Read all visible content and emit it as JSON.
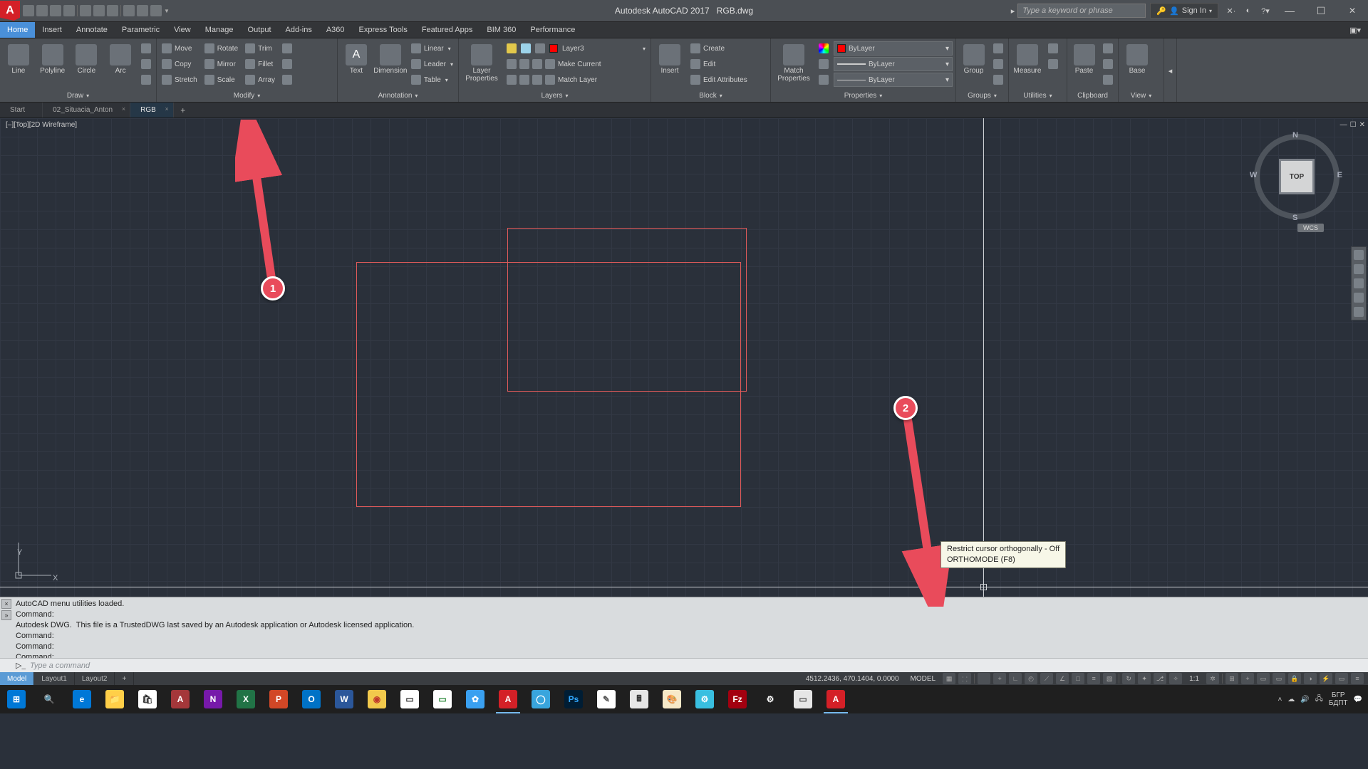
{
  "title": {
    "app": "Autodesk AutoCAD 2017",
    "file": "RGB.dwg"
  },
  "search_placeholder": "Type a keyword or phrase",
  "signin": "Sign In",
  "menu": [
    "Home",
    "Insert",
    "Annotate",
    "Parametric",
    "View",
    "Manage",
    "Output",
    "Add-ins",
    "A360",
    "Express Tools",
    "Featured Apps",
    "BIM 360",
    "Performance"
  ],
  "menu_active": 0,
  "ribbon": {
    "draw": {
      "big": [
        "Line",
        "Polyline",
        "Circle",
        "Arc"
      ],
      "title": "Draw"
    },
    "modify": {
      "rows": [
        [
          "Move",
          "Rotate",
          "Trim"
        ],
        [
          "Copy",
          "Mirror",
          "Fillet"
        ],
        [
          "Stretch",
          "Scale",
          "Array"
        ]
      ],
      "title": "Modify"
    },
    "annotation": {
      "big": [
        "Text",
        "Dimension"
      ],
      "rows": [
        "Linear",
        "Leader",
        "Table"
      ],
      "title": "Annotation"
    },
    "layers": {
      "big": "Layer\nProperties",
      "rows": [
        "Layer3",
        "Make Current",
        "Match Layer"
      ],
      "title": "Layers"
    },
    "block": {
      "big": "Insert",
      "rows": [
        "Create",
        "Edit",
        "Edit Attributes"
      ],
      "title": "Block"
    },
    "properties": {
      "big": "Match\nProperties",
      "combos": [
        "ByLayer",
        "ByLayer",
        "ByLayer"
      ],
      "title": "Properties"
    },
    "groups": {
      "big": "Group",
      "title": "Groups"
    },
    "utilities": {
      "big": "Measure",
      "title": "Utilities"
    },
    "clipboard": {
      "big": "Paste",
      "title": "Clipboard"
    },
    "base": {
      "big": "Base",
      "title": "View"
    }
  },
  "filetabs": {
    "items": [
      "Start",
      "02_Situacia_Anton",
      "RGB"
    ],
    "active": 2
  },
  "viewstate": "[–][Top][2D Wireframe]",
  "viewcube": {
    "face": "TOP",
    "n": "N",
    "s": "S",
    "e": "E",
    "w": "W",
    "wcs": "WCS"
  },
  "annotations": {
    "one": "1",
    "two": "2"
  },
  "tooltip": {
    "line1": "Restrict cursor orthogonally - Off",
    "line2": "ORTHOMODE (F8)"
  },
  "cmd_history": "AutoCAD menu utilities loaded.\nCommand:\nAutodesk DWG.  This file is a TrustedDWG last saved by an Autodesk application or Autodesk licensed application.\nCommand:\nCommand:\nCommand:",
  "cmd_placeholder": "Type a command",
  "layouts": {
    "items": [
      "Model",
      "Layout1",
      "Layout2"
    ],
    "active": 0
  },
  "status": {
    "coords": "4512.2436, 470.1404, 0.0000",
    "space": "MODEL",
    "scale": "1:1"
  },
  "tray": {
    "lang1": "БГР",
    "lang2": "БДПТ"
  },
  "taskbar_icons": [
    {
      "bg": "#0078d7",
      "fg": "#fff",
      "txt": "⊞"
    },
    {
      "bg": "#1f1f1f",
      "fg": "#fff",
      "txt": "🔍"
    },
    {
      "bg": "#0078d7",
      "fg": "#fff",
      "txt": "e"
    },
    {
      "bg": "#ffcf48",
      "fg": "#8a5a00",
      "txt": "📁"
    },
    {
      "bg": "#fff",
      "fg": "#333",
      "txt": "🛍"
    },
    {
      "bg": "#a4373a",
      "fg": "#fff",
      "txt": "A"
    },
    {
      "bg": "#7719aa",
      "fg": "#fff",
      "txt": "N"
    },
    {
      "bg": "#217346",
      "fg": "#fff",
      "txt": "X"
    },
    {
      "bg": "#d24726",
      "fg": "#fff",
      "txt": "P"
    },
    {
      "bg": "#0072c6",
      "fg": "#fff",
      "txt": "O"
    },
    {
      "bg": "#2b579a",
      "fg": "#fff",
      "txt": "W"
    },
    {
      "bg": "#f2c94c",
      "fg": "#c0392b",
      "txt": "◉"
    },
    {
      "bg": "#fff",
      "fg": "#333",
      "txt": "▭"
    },
    {
      "bg": "#fff",
      "fg": "#2e8b3d",
      "txt": "▭"
    },
    {
      "bg": "#3aa0f0",
      "fg": "#fff",
      "txt": "✿"
    },
    {
      "bg": "#d42027",
      "fg": "#fff",
      "txt": "A"
    },
    {
      "bg": "#39a5dd",
      "fg": "#fff",
      "txt": "◯"
    },
    {
      "bg": "#001d34",
      "fg": "#31a8ff",
      "txt": "Ps"
    },
    {
      "bg": "#fff",
      "fg": "#555",
      "txt": "✎"
    },
    {
      "bg": "#e6e6e6",
      "fg": "#333",
      "txt": "🖩"
    },
    {
      "bg": "#f7e9c8",
      "fg": "#8a5a00",
      "txt": "🎨"
    },
    {
      "bg": "#39bfe0",
      "fg": "#fff",
      "txt": "⚙"
    },
    {
      "bg": "#a30010",
      "fg": "#fff",
      "txt": "Fz"
    },
    {
      "bg": "#1f1f1f",
      "fg": "#fff",
      "txt": "⚙"
    },
    {
      "bg": "#e6e6e6",
      "fg": "#555",
      "txt": "▭"
    },
    {
      "bg": "#d42027",
      "fg": "#fff",
      "txt": "A"
    }
  ]
}
